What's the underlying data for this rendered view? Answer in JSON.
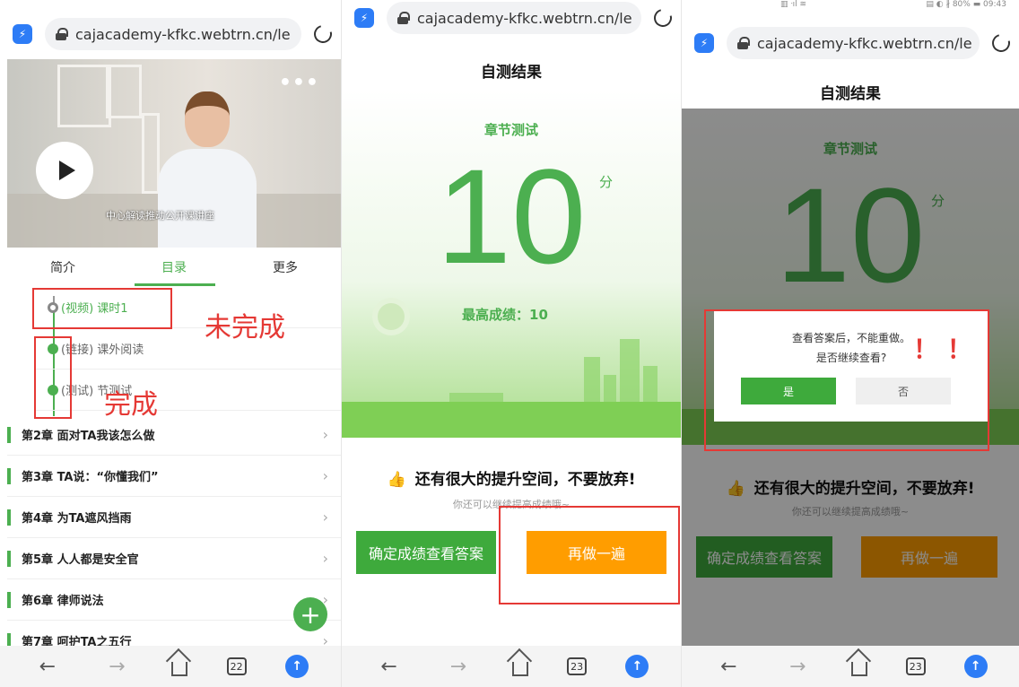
{
  "browser": {
    "url": "cajacademy-kfkc.webtrn.cn/le",
    "status_left": "▥ ᐧıl ≋",
    "status_right": "▤ ◐ ∦ 80% ▬ 09:43",
    "tab_count_1": "22",
    "tab_count_2": "23",
    "tab_count_3": "23"
  },
  "video": {
    "caption": "中心解读推动公开课讲座",
    "more": "•••"
  },
  "course": {
    "tabs": [
      "简介",
      "目录",
      "更多"
    ],
    "active_tab": "目录",
    "lessons": [
      {
        "label": "(视频) 课时1",
        "status": "incomplete"
      },
      {
        "label": "(链接) 课外阅读",
        "status": "complete"
      },
      {
        "label": "(测试) 节测试",
        "status": "complete"
      }
    ],
    "chapters": [
      "第2章 面对TA我该怎么做",
      "第3章 TA说：“你懂我们”",
      "第4章 为TA遮风挡雨",
      "第5章 人人都是安全官",
      "第6章 律师说法",
      "第7章 呵护TA之五行"
    ],
    "annotations": {
      "incomplete": "未完成",
      "complete": "完成"
    }
  },
  "result": {
    "title": "自测结果",
    "section": "章节测试",
    "score": "10",
    "unit": "分",
    "best_label": "最高成绩：10",
    "encourage": "还有很大的提升空间，不要放弃!",
    "sub_tip": "你还可以继续提高成绩哦~",
    "confirm_button": "确定成绩查看答案",
    "retry_button": "再做一遍"
  },
  "dialog": {
    "line1": "查看答案后，不能重做。",
    "line2": "是否继续查看?",
    "yes": "是",
    "no": "否",
    "marks": "！ ！"
  },
  "icons": {
    "back": "←",
    "forward": "→",
    "chevron": "›",
    "thumb": "👍",
    "plus": "+",
    "upload": "↑",
    "app": "⚡"
  },
  "colors": {
    "accent_green": "#4caf50",
    "button_green": "#3eaa3c",
    "orange": "#ff9d00",
    "annotation_red": "#e53935",
    "browser_blue": "#2d7cf6"
  }
}
